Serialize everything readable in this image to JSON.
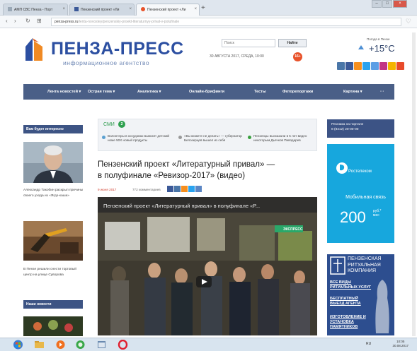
{
  "browser": {
    "tabs": [
      {
        "label": "АМП СВС Пенза - Порт"
      },
      {
        "label": "Пензенский проект «Ли"
      },
      {
        "label": "Пензенский проект «Ли"
      }
    ],
    "url_host": "penza-press.ru",
    "url_rest": "/lenta-novostey/penzenskiy-proekt-literaturnyy-prival-v-polufinale"
  },
  "header": {
    "logo_title": "ПЕНЗА-ПРЕСС",
    "logo_subtitle": "информационное агентство",
    "search_placeholder": "Поиск",
    "search_button": "Найти",
    "date": "30 АВГУСТА 2017, СРЕДА, 10:00",
    "age_rating": "16+",
    "weather_city": "Погода в Пензе",
    "weather_temp": "+15°C"
  },
  "nav": {
    "items": [
      {
        "label": "Лента новостей ▾"
      },
      {
        "label": "Острая тема ▾"
      },
      {
        "label": "Аналитика ▾"
      },
      {
        "label": "Онлайн-брифинги"
      },
      {
        "label": "Тесты"
      },
      {
        "label": "Фоторепортажи"
      },
      {
        "label": "Картина ▾"
      },
      {
        "label": "···"
      }
    ]
  },
  "left": {
    "section1_title": "Вам будет интересно",
    "story1": "Александр Такобин раскрыл причины своего ухода из «Ягдо-каша»",
    "story2": "В Пензе решили снести торговый центр на улице Суворова",
    "section2_title": "Наши новости"
  },
  "smi": {
    "label": "СМИ",
    "count": "2",
    "news": [
      {
        "text": "Волонтеры в хосудовах вывозят детский номе 50Х новый продукты"
      },
      {
        "text": "«Вы можете не делать» — губернатор Белозерцев вышел из себя"
      },
      {
        "text": "Пензенцы высказали в 5 лет видео некоторым Дьячков Пиводарев"
      }
    ]
  },
  "article": {
    "headline_line1": "Пензенский проект «Литературный привал» —",
    "headline_line2": "в полуфинале «Ревизор-2017» (видео)",
    "date": "9 июня 2017",
    "comments": "772 комментариев",
    "video_title": "Пензенский проект «Литературный привал» в полуфинале «Р...",
    "video_logo": "ЭКСПРЕСС"
  },
  "right": {
    "head_line1": "Реклама на портале",
    "head_line2": "8 (8412) 20-00-00",
    "rt_brand": "Ростелеком",
    "rt_line": "Мобильная связь",
    "rt_price": "200",
    "rt_unit1": "руб.*",
    "rt_unit2": "мес",
    "rit_title": "ПЕНЗЕНСКАЯ РИТУАЛЬНАЯ КОМПАНИЯ",
    "rit_items": [
      {
        "label": "ВСЕ ВИДЫ РИТУАЛЬНЫХ УСЛУГ"
      },
      {
        "label": "БЕСПЛАТНЫЙ ВЫЕЗД АГЕНТА"
      },
      {
        "label": "ИЗГОТОВЛЕНИЕ И УСТАНОВКА ПАМЯТНИКОВ"
      }
    ]
  },
  "taskbar": {
    "lang": "RU",
    "time": "10:05",
    "date": "30.08.2017"
  },
  "colors": {
    "brand_blue": "#2c4fa1",
    "nav_bg": "#4a5f87",
    "rostelecom": "#17a7dd",
    "ritual_bg": "#2d4e8f",
    "accent_red": "#e8522a"
  }
}
